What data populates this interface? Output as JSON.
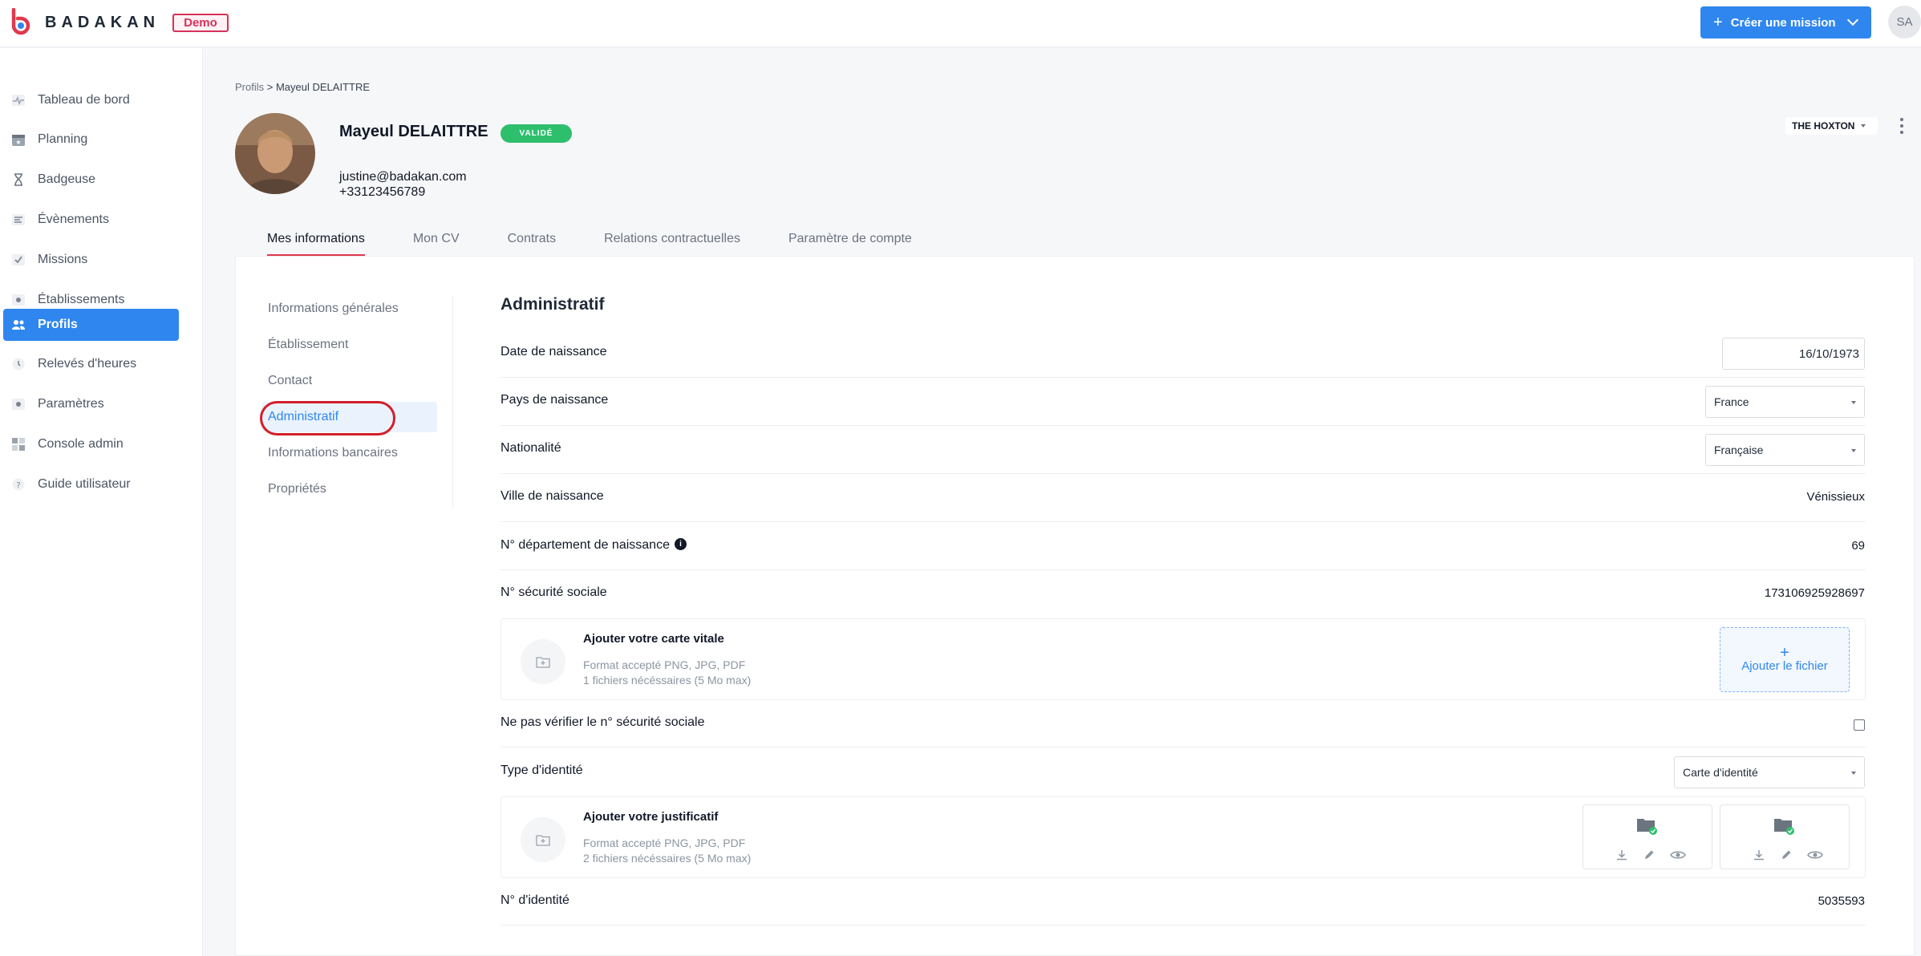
{
  "app": {
    "name": "BADAKAN",
    "env_badge": "Demo"
  },
  "header": {
    "create_label": "Créer une mission",
    "user_initials": "SA"
  },
  "sidebar": {
    "items": [
      {
        "label": "Tableau de bord",
        "icon": "pulse-icon"
      },
      {
        "label": "Planning",
        "icon": "calendar-star-icon"
      },
      {
        "label": "Badgeuse",
        "icon": "hourglass-icon"
      },
      {
        "label": "Évènements",
        "icon": "list-icon"
      },
      {
        "label": "Missions",
        "icon": "check-square-icon"
      },
      {
        "label": "Établissements",
        "icon": "location-icon"
      },
      {
        "label": "Profils",
        "icon": "users-icon",
        "active": true
      },
      {
        "label": "Relevés d'heures",
        "icon": "clock-icon"
      },
      {
        "label": "Paramètres",
        "icon": "gear-icon"
      },
      {
        "label": "Console admin",
        "icon": "grid-icon"
      },
      {
        "label": "Guide utilisateur",
        "icon": "help-icon"
      }
    ]
  },
  "breadcrumb": {
    "parent": "Profils",
    "separator": ">",
    "current": "Mayeul DELAITTRE"
  },
  "profile": {
    "name": "Mayeul DELAITTRE",
    "status": "VALIDÉ",
    "email": "justine@badakan.com",
    "phone": "+33123456789",
    "organization": "THE HOXTON"
  },
  "tabs": [
    {
      "label": "Mes informations",
      "active": true
    },
    {
      "label": "Mon CV"
    },
    {
      "label": "Contrats"
    },
    {
      "label": "Relations contractuelles"
    },
    {
      "label": "Paramètre de compte"
    }
  ],
  "subnav": [
    {
      "label": "Informations générales"
    },
    {
      "label": "Établissement"
    },
    {
      "label": "Contact"
    },
    {
      "label": "Administratif",
      "active": true
    },
    {
      "label": "Informations bancaires"
    },
    {
      "label": "Propriétés"
    }
  ],
  "admin": {
    "title": "Administratif",
    "birth_date": {
      "label": "Date de naissance",
      "value": "16/10/1973"
    },
    "birth_country": {
      "label": "Pays de naissance",
      "value": "France"
    },
    "nationality": {
      "label": "Nationalité",
      "value": "Française"
    },
    "birth_city": {
      "label": "Ville de naissance",
      "value": "Vénissieux"
    },
    "birth_dept": {
      "label": "N° département de naissance",
      "value": "69",
      "info": "i"
    },
    "social_security": {
      "label": "N° sécurité sociale",
      "value": "173106925928697"
    },
    "vitale_upload": {
      "title": "Ajouter votre carte vitale",
      "formats": "Format accepté PNG, JPG, PDF",
      "required": "1 fichiers nécéssaires (5 Mo max)",
      "button_plus": "+",
      "button_label": "Ajouter le fichier"
    },
    "skip_ssn_check": {
      "label": "Ne pas vérifier le n° sécurité sociale",
      "checked": false
    },
    "id_type": {
      "label": "Type d'identité",
      "value": "Carte d'identité"
    },
    "id_upload": {
      "title": "Ajouter votre justificatif",
      "formats": "Format accepté PNG, JPG, PDF",
      "required": "2 fichiers nécéssaires (5 Mo max)"
    },
    "id_number": {
      "label": "N° d'identité",
      "value": "5035593"
    }
  },
  "colors": {
    "accent": "#2f86ef",
    "status_ok": "#2ebf6d",
    "brand_red": "#d4325a",
    "annotation": "#d21f2b"
  }
}
